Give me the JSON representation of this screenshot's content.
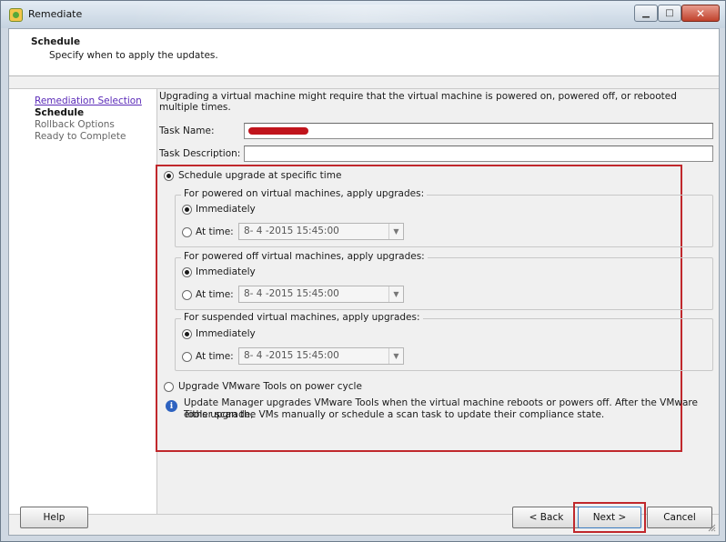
{
  "window": {
    "title": "Remediate",
    "minimize_glyph": "▁",
    "maximize_glyph": "□",
    "close_glyph": "✕"
  },
  "header": {
    "title": "Schedule",
    "subtitle": "Specify when to apply the updates."
  },
  "nav": {
    "items": [
      {
        "label": "Remediation Selection",
        "state": "link"
      },
      {
        "label": "Schedule",
        "state": "current"
      },
      {
        "label": "Rollback Options",
        "state": "pending"
      },
      {
        "label": "Ready to Complete",
        "state": "pending"
      }
    ]
  },
  "main": {
    "intro": "Upgrading a virtual machine might require that the virtual machine is powered on, powered off, or rebooted multiple times.",
    "task_name_label": "Task Name:",
    "task_name_value": "",
    "task_description_label": "Task Description:",
    "task_description_value": "",
    "schedule_option_label": "Schedule upgrade at specific time",
    "groups": [
      {
        "legend": "For powered on virtual machines, apply upgrades:",
        "immediately_label": "Immediately",
        "at_time_label": "At time:",
        "datetime_value": "8- 4 -2015 15:45:00"
      },
      {
        "legend": "For powered off virtual machines, apply upgrades:",
        "immediately_label": "Immediately",
        "at_time_label": "At time:",
        "datetime_value": "8- 4 -2015 15:45:00"
      },
      {
        "legend": "For suspended virtual machines, apply upgrades:",
        "immediately_label": "Immediately",
        "at_time_label": "At time:",
        "datetime_value": "8- 4 -2015 15:45:00"
      }
    ],
    "tools_option_label": "Upgrade VMware Tools on power cycle",
    "info_line1": "Update Manager upgrades VMware Tools when the virtual machine reboots or powers off. After the VMware Tools upgrade,",
    "info_line2": "either scan the VMs manually or schedule a scan task to update their compliance state.",
    "info_icon_glyph": "i"
  },
  "footer": {
    "help_label": "Help",
    "back_label": "< Back",
    "next_label": "Next >",
    "cancel_label": "Cancel"
  },
  "colors": {
    "highlight_border": "#c0282c",
    "link": "#5b2bb8",
    "redaction": "#c0141c"
  },
  "icons": {
    "app": "remediate-app-icon",
    "info": "info-icon",
    "dropdown": "chevron-down-icon"
  }
}
